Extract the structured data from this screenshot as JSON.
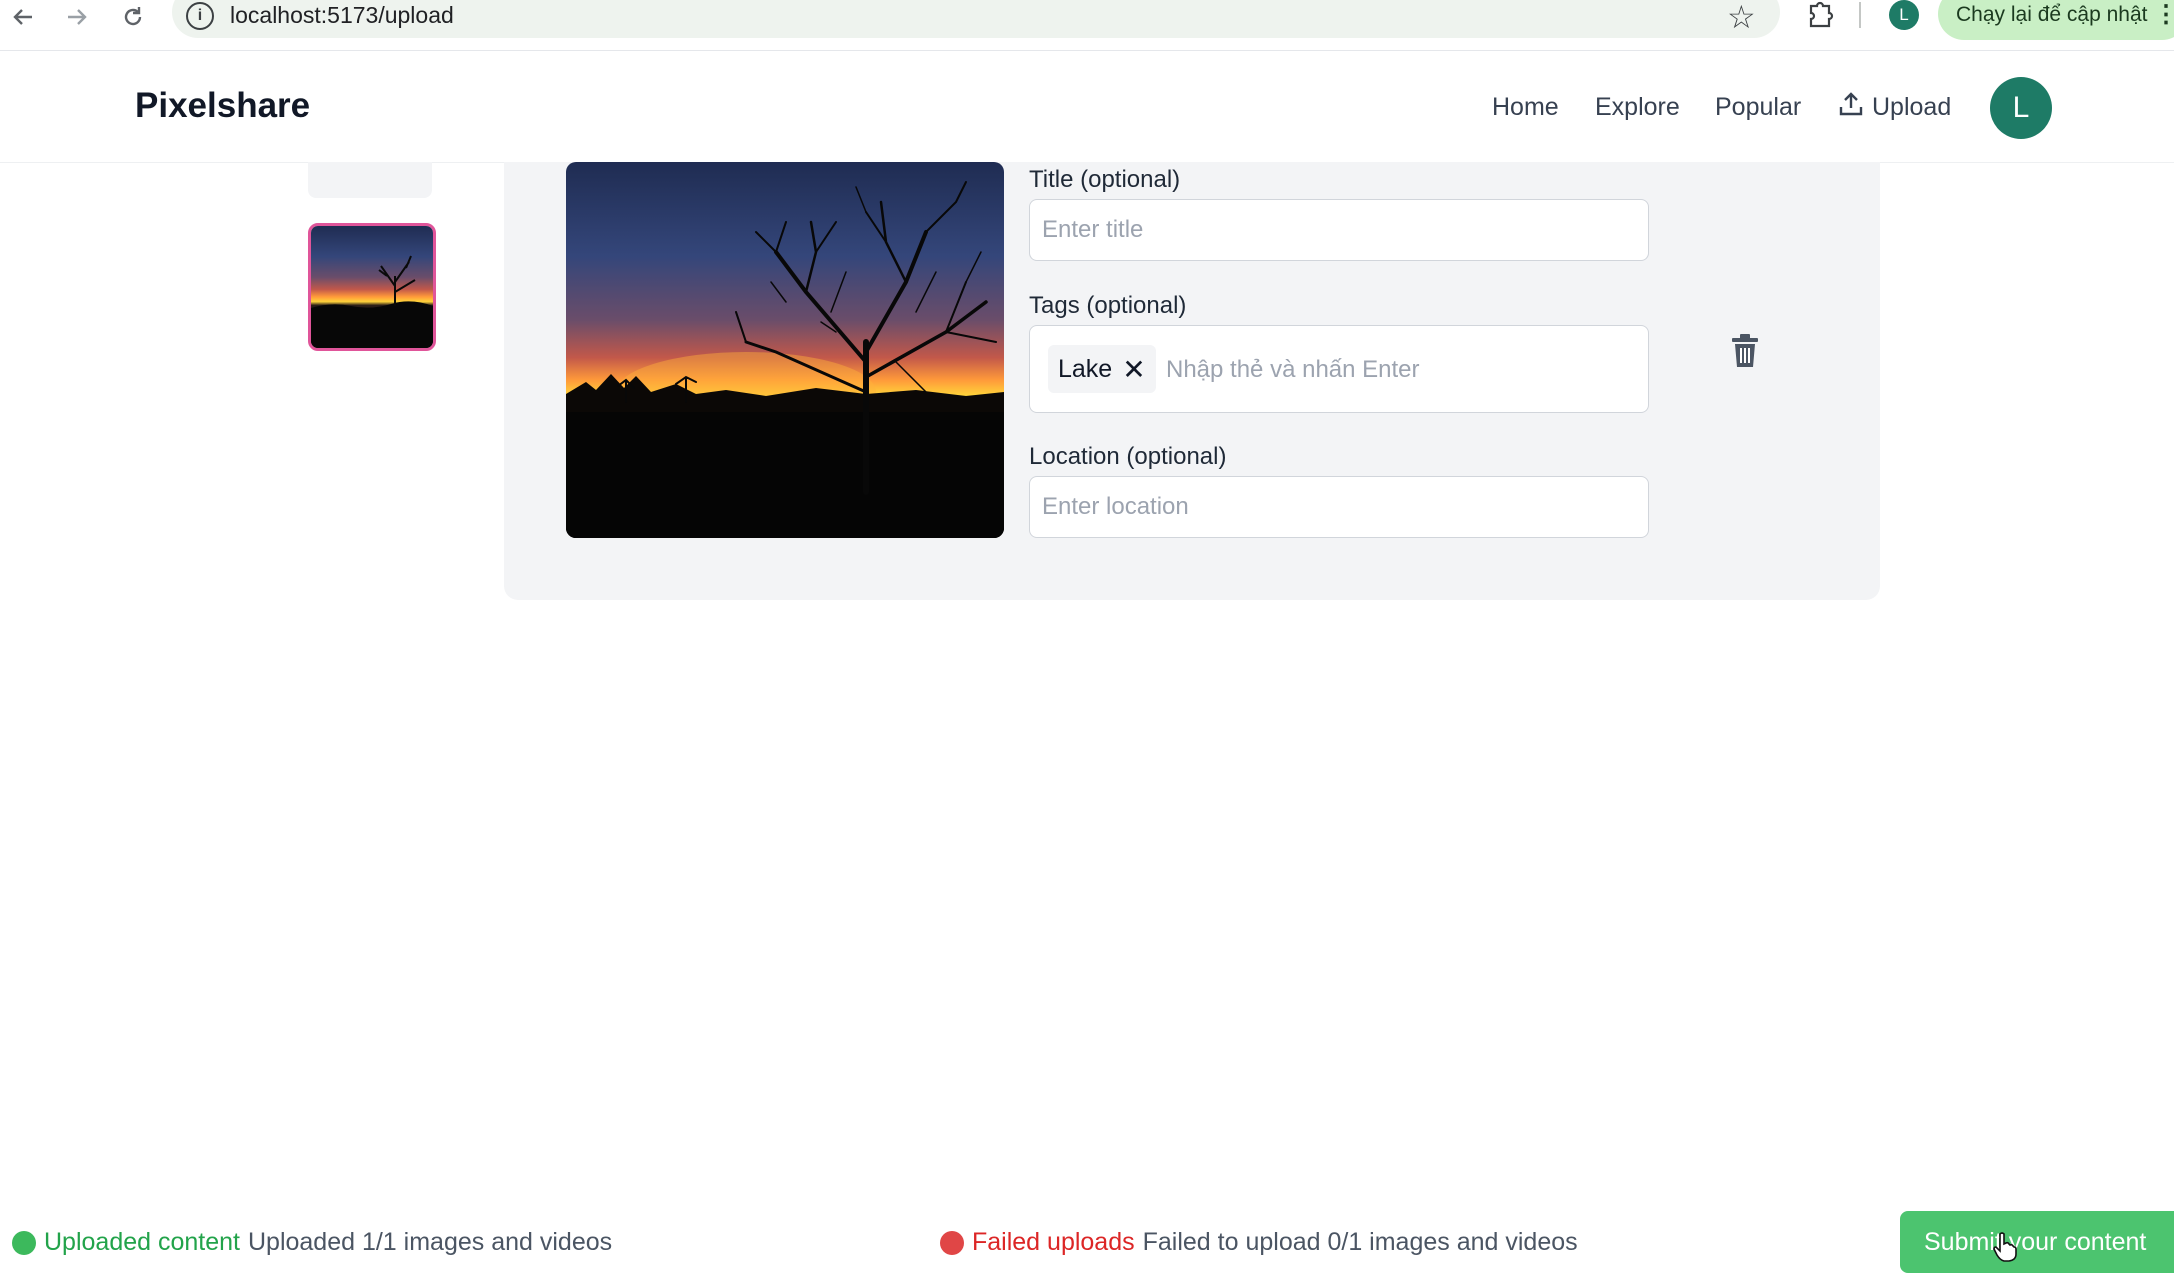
{
  "browser": {
    "url": "localhost:5173/upload",
    "update_button": "Chạy lại để cập nhật",
    "profile_initial": "L"
  },
  "header": {
    "brand": "Pixelshare",
    "nav": {
      "home": "Home",
      "explore": "Explore",
      "popular": "Popular",
      "upload": "Upload"
    },
    "avatar_initial": "L"
  },
  "form": {
    "title_label": "Title (optional)",
    "title_value": "",
    "title_placeholder": "Enter title",
    "tags_label": "Tags (optional)",
    "tags": [
      "Lake"
    ],
    "tags_placeholder": "Nhập thẻ và nhấn Enter",
    "location_label": "Location (optional)",
    "location_value": "",
    "location_placeholder": "Enter location"
  },
  "status": {
    "uploaded_title": "Uploaded content",
    "uploaded_detail": "Uploaded 1/1 images and videos",
    "failed_title": "Failed uploads",
    "failed_detail": "Failed to upload 0/1 images and videos",
    "submit_label": "Submit your content"
  },
  "colors": {
    "accent_green": "#4cc46f",
    "error_red": "#dc2626",
    "selected_border": "#e0559a",
    "avatar_teal": "#1e7b66"
  },
  "icons": [
    "back-arrow-icon",
    "forward-arrow-icon",
    "reload-icon",
    "site-info-icon",
    "bookmark-star-icon",
    "extensions-icon",
    "upload-icon",
    "close-icon",
    "trash-icon",
    "hand-cursor-icon"
  ]
}
